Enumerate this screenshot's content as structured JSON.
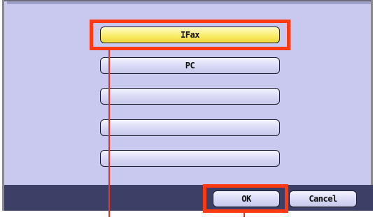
{
  "destinations": [
    {
      "label": "IFax",
      "selected": true
    },
    {
      "label": "PC",
      "selected": false
    },
    {
      "label": "",
      "selected": false
    },
    {
      "label": "",
      "selected": false
    },
    {
      "label": "",
      "selected": false
    }
  ],
  "buttons": {
    "ok_label": "OK",
    "cancel_label": "Cancel"
  },
  "colors": {
    "screen_bg": "#c9c9ef",
    "bottom_bar": "#3c3f66",
    "selected_fill": "#f9ee6a",
    "callout_highlight": "#ff3a12"
  }
}
